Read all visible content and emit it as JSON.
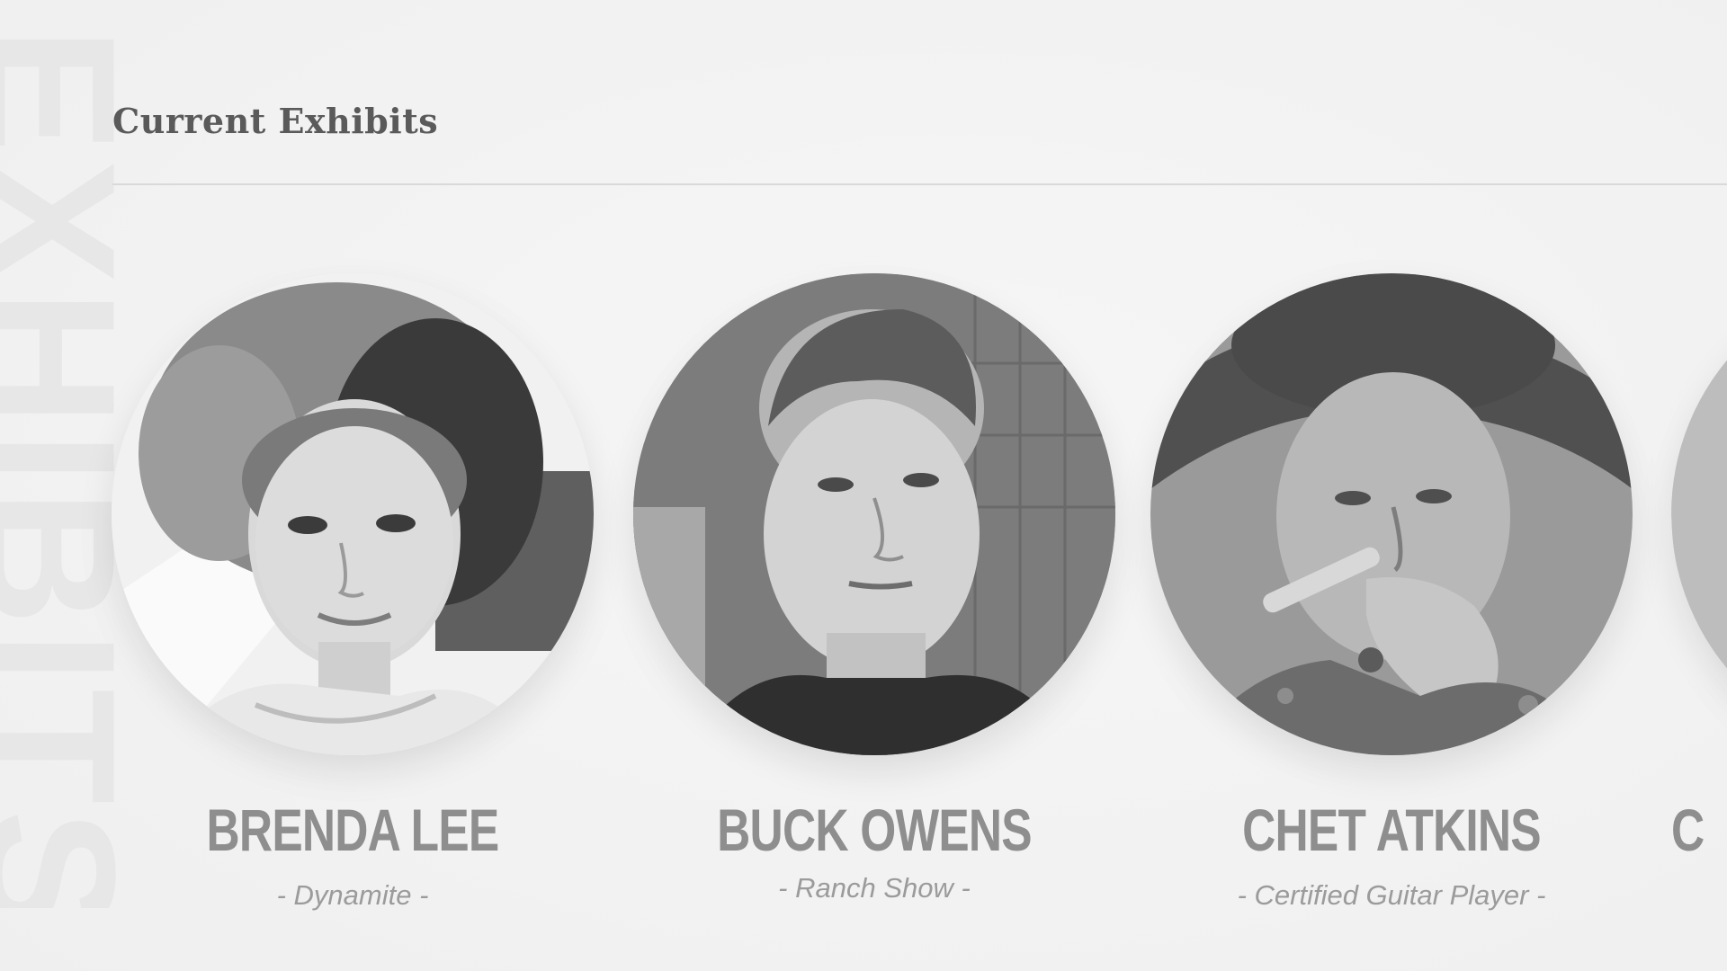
{
  "watermark": "EXHIBITS",
  "section": {
    "title": "Current Exhibits"
  },
  "exhibits": [
    {
      "name": "BRENDA LEE",
      "subtitle": "- Dynamite -",
      "portrait_icon": "woman-portrait"
    },
    {
      "name": "BUCK OWENS",
      "subtitle": "- Ranch Show -",
      "portrait_icon": "man-portrait"
    },
    {
      "name": "CHET ATKINS",
      "subtitle": "- Certified Guitar Player -",
      "portrait_icon": "man-hat-cigar-portrait"
    },
    {
      "name": "C",
      "subtitle": "",
      "portrait_icon": "partial-portrait"
    }
  ],
  "colors": {
    "background": "#f3f3f3",
    "title": "#5a5a5a",
    "name": "#8e8e8e",
    "subtitle": "#9b9b9b"
  }
}
